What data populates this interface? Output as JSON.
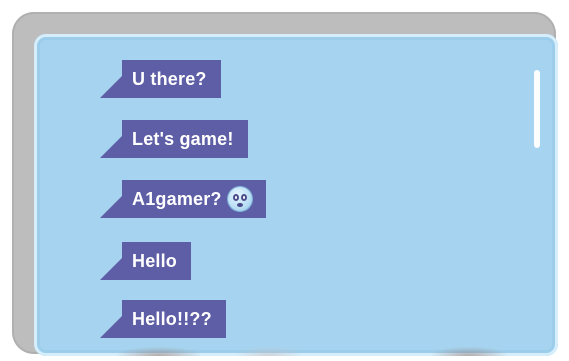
{
  "chat": {
    "messages": [
      {
        "text": "U there?",
        "emoji": null
      },
      {
        "text": "Let's game!",
        "emoji": null
      },
      {
        "text": "A1gamer?",
        "emoji": "worried-face-emoji"
      },
      {
        "text": "Hello",
        "emoji": null
      },
      {
        "text": "Hello!!??",
        "emoji": null
      }
    ]
  },
  "colors": {
    "frame": "#bdbdbd",
    "screen": "#a6d4f0",
    "bubble": "#5e5ea7",
    "bubble_text": "#ffffff",
    "scrollbar": "#ffffff"
  }
}
